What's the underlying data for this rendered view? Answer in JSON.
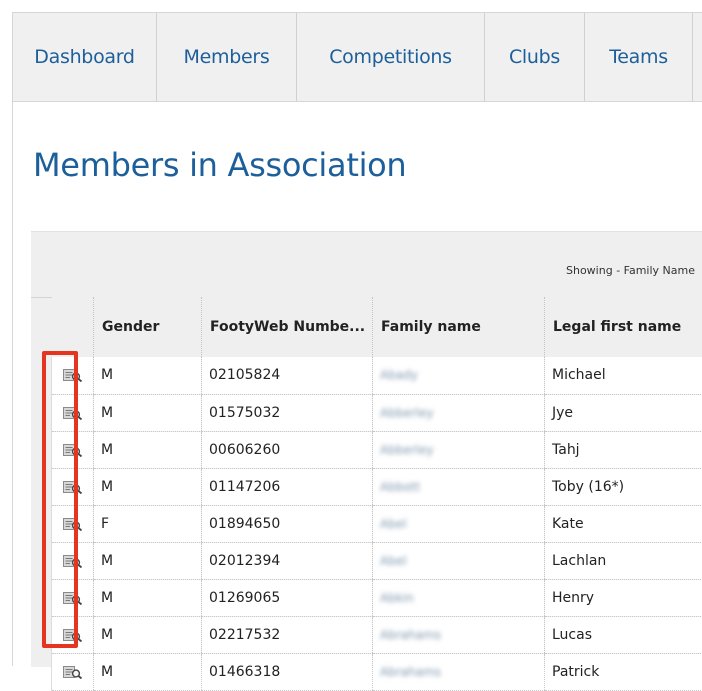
{
  "nav": {
    "items": [
      {
        "label": "Dashboard"
      },
      {
        "label": "Members"
      },
      {
        "label": "Competitions"
      },
      {
        "label": "Clubs"
      },
      {
        "label": "Teams"
      }
    ]
  },
  "page": {
    "title": "Members in Association",
    "showing_text": "Showing - Family Name"
  },
  "table": {
    "columns": [
      "",
      "Gender",
      "FootyWeb Numbe...",
      "Family name",
      "Legal first name"
    ],
    "rows": [
      {
        "gender": "M",
        "number": "02105824",
        "family": "Abady",
        "first": "Michael"
      },
      {
        "gender": "M",
        "number": "01575032",
        "family": "Abberley",
        "first": "Jye"
      },
      {
        "gender": "M",
        "number": "00606260",
        "family": "Abberley",
        "first": "Tahj"
      },
      {
        "gender": "M",
        "number": "01147206",
        "family": "Abbott",
        "first": "Toby (16*)"
      },
      {
        "gender": "F",
        "number": "01894650",
        "family": "Abel",
        "first": "Kate"
      },
      {
        "gender": "M",
        "number": "02012394",
        "family": "Abel",
        "first": "Lachlan"
      },
      {
        "gender": "M",
        "number": "01269065",
        "family": "Abkin",
        "first": "Henry"
      },
      {
        "gender": "M",
        "number": "02217532",
        "family": "Abrahams",
        "first": "Lucas"
      },
      {
        "gender": "M",
        "number": "01466318",
        "family": "Abrahams",
        "first": "Patrick"
      }
    ]
  },
  "colors": {
    "link": "#1d5f9a",
    "highlight": "#e5341f"
  },
  "icons": {
    "view_record": "view-record-icon"
  }
}
